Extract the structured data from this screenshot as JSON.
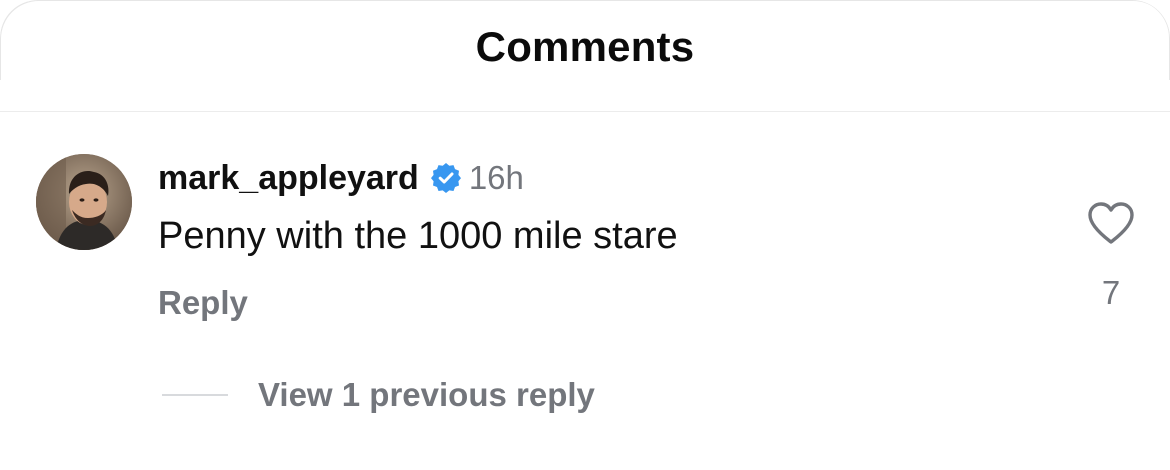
{
  "header": {
    "title": "Comments"
  },
  "comment": {
    "avatar_icon": "user-avatar-photo",
    "username": "mark_appleyard",
    "verified_icon": "verified-badge-icon",
    "timestamp": "16h",
    "text": "Penny with the 1000 mile stare",
    "reply_label": "Reply",
    "like_icon": "heart-outline-icon",
    "like_count": "7"
  },
  "replies": {
    "view_label": "View 1 previous reply"
  },
  "colors": {
    "verified": "#3897f0",
    "secondary_text": "#73767c",
    "primary_text": "#111111"
  }
}
